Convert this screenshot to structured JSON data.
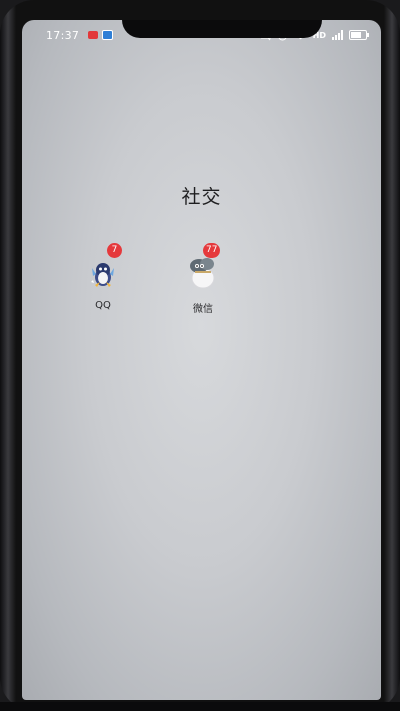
{
  "status_bar": {
    "time": "17:37",
    "network_label": "HD",
    "battery_level": 0.85,
    "icons": [
      "notification-red-icon",
      "notification-blue-icon",
      "mute-icon",
      "alarm-icon",
      "wifi-icon",
      "signal-icon",
      "battery-icon"
    ]
  },
  "folder": {
    "title": "社交",
    "apps": [
      {
        "label": "QQ",
        "badge": "7",
        "icon": "qq-app-icon"
      },
      {
        "label": "微信",
        "badge": "77",
        "icon": "wechat-app-icon"
      }
    ]
  },
  "colors": {
    "badge": "#e5393c",
    "folder_bg": "#c9cbcf"
  }
}
